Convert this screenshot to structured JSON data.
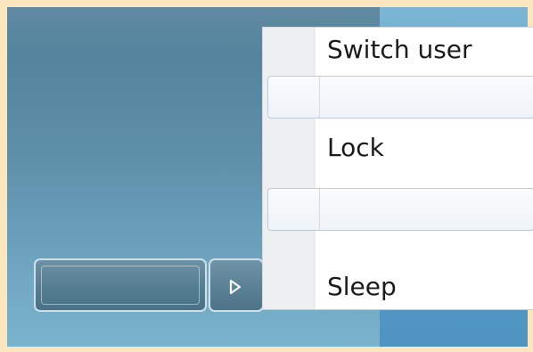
{
  "menu": {
    "items": [
      {
        "label": "Switch user"
      },
      {
        "label": "Lock"
      },
      {
        "label": "Sleep"
      }
    ]
  },
  "shutdown": {
    "arrow_icon": "chevron-right-icon"
  },
  "colors": {
    "page_border": "#fbe6bf",
    "desktop_blue": "#5f90aa",
    "menu_text": "#1b1b1b"
  }
}
